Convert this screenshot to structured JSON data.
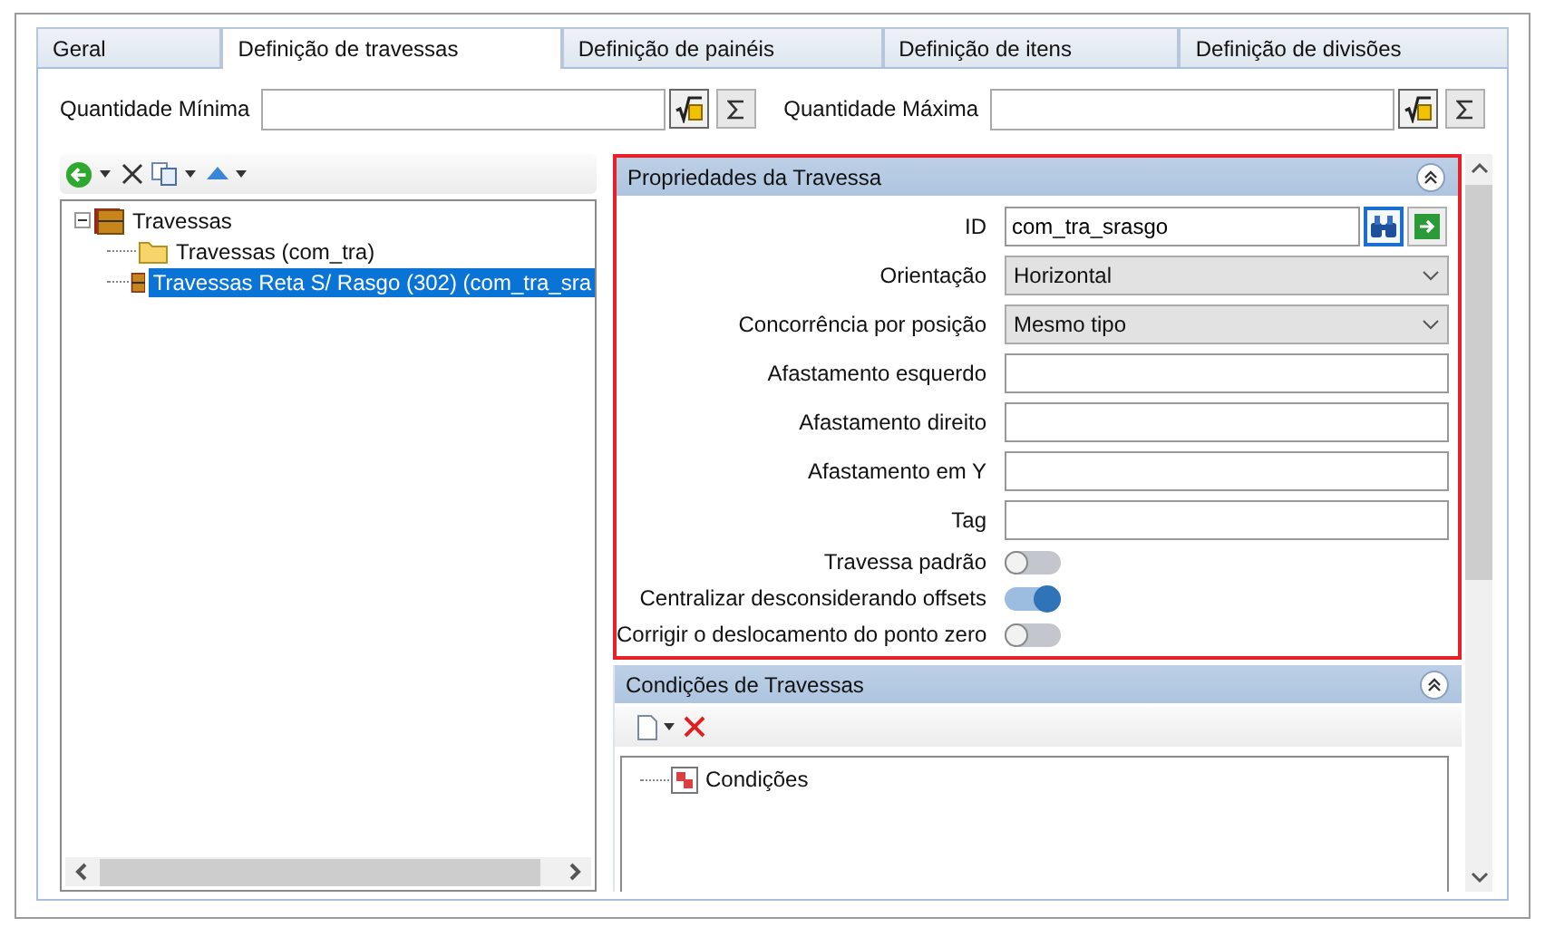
{
  "tabs": [
    {
      "label": "Geral",
      "selected": false
    },
    {
      "label": "Definição de travessas",
      "selected": true
    },
    {
      "label": "Definição de painéis",
      "selected": false
    },
    {
      "label": "Definição de itens",
      "selected": false
    },
    {
      "label": "Definição de divisões",
      "selected": false
    }
  ],
  "quantity_fields": [
    {
      "label": "Quantidade Mínima"
    },
    {
      "label": "Quantidade Máxima"
    }
  ],
  "tree": [
    {
      "label": "Travessas",
      "kind": "group",
      "selected": false,
      "expanded": true,
      "children": [
        {
          "label": "Travessas (com_tra)",
          "kind": "folder",
          "selected": false
        },
        {
          "label": "Travessas Reta S/ Rasgo  (302) (com_tra_sra",
          "kind": "item",
          "selected": true
        }
      ]
    }
  ],
  "properties": {
    "title": "Propriedades da Travessa",
    "highlighted": true,
    "rows": [
      {
        "label": "ID",
        "kind": "lookup",
        "value": "com_tra_srasgo"
      },
      {
        "label": "Orientação",
        "kind": "select",
        "value": "Horizontal"
      },
      {
        "label": "Concorrência por posição",
        "kind": "select",
        "value": "Mesmo tipo"
      },
      {
        "label": "Afastamento esquerdo",
        "kind": "text"
      },
      {
        "label": "Afastamento direito",
        "kind": "text"
      },
      {
        "label": "Afastamento em Y",
        "kind": "text"
      },
      {
        "label": "Tag",
        "kind": "text"
      },
      {
        "label": "Travessa padrão",
        "kind": "toggle",
        "on": false
      },
      {
        "label": "Centralizar desconsiderando offsets",
        "kind": "toggle",
        "on": true
      },
      {
        "label": "Corrigir o deslocamento do ponto zero",
        "kind": "toggle",
        "on": false
      }
    ]
  },
  "conditions": {
    "title": "Condições de Travessas",
    "tree": [
      {
        "label": "Condições"
      }
    ]
  }
}
